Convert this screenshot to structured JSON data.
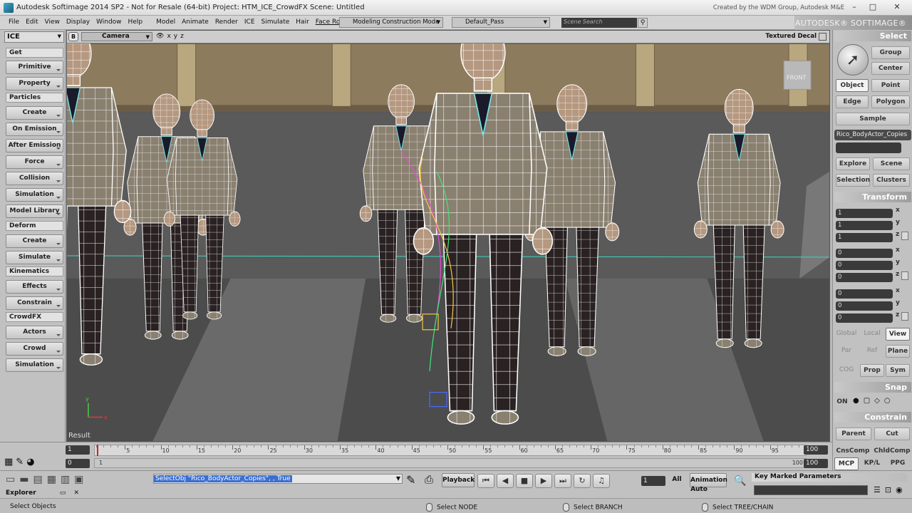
{
  "window": {
    "title": "Autodesk Softimage 2014 SP2  - Not for Resale (64-bit)    Project: HTM_ICE_CrowdFX    Scene: Untitled",
    "credit": "Created by the WDM Group, Autodesk M&E",
    "controls": [
      "–",
      "□",
      "✕"
    ]
  },
  "menubar": {
    "items": [
      "File",
      "Edit",
      "View",
      "Display",
      "Window",
      "Help",
      "Model",
      "Animate",
      "Render",
      "ICE",
      "Simulate",
      "Hair",
      "Face Robot"
    ],
    "mode_combo": "Modeling Construction Mode",
    "pass_combo": "Default_Pass",
    "search_placeholder": "Scene Search",
    "brand": "AUTODESK® SOFTIMAGE®"
  },
  "left_toolbar": {
    "selector": "ICE",
    "sections": [
      {
        "header": "Get",
        "buttons": [
          "Primitive",
          "Property"
        ]
      },
      {
        "header": "Particles",
        "buttons": [
          "Create",
          "On Emission",
          "After Emission",
          "Force",
          "Collision",
          "Simulation",
          "Model Library"
        ]
      },
      {
        "header": "Deform",
        "buttons": [
          "Create",
          "Simulate"
        ]
      },
      {
        "header": "Kinematics",
        "buttons": [
          "Effects",
          "Constrain"
        ]
      },
      {
        "header": "CrowdFX",
        "buttons": [
          "Actors",
          "Crowd",
          "Simulation"
        ]
      }
    ]
  },
  "viewport": {
    "b_label": "B",
    "camera": "Camera",
    "shading": "Textured Decal",
    "tools": [
      "👁",
      "x",
      "y",
      "z"
    ],
    "result_label": "Result",
    "front_label": "FRONT",
    "axis_letters": [
      "y",
      "x"
    ]
  },
  "right_panel": {
    "select_header": "Select",
    "group": "Group",
    "center": "Center",
    "object": "Object",
    "point": "Point",
    "edge": "Edge",
    "polygon": "Polygon",
    "sample": "Sample",
    "selected_name": "Rico_BodyActor_Copies",
    "explore": "Explore",
    "scene": "Scene",
    "selection": "Selection",
    "clusters": "Clusters",
    "transform_header": "Transform",
    "scale": [
      "1",
      "1",
      "1"
    ],
    "rotate": [
      "0",
      "0",
      "0"
    ],
    "translate": [
      "0",
      "0",
      "0"
    ],
    "axes": [
      "x",
      "y",
      "z"
    ],
    "global": "Global",
    "local": "Local",
    "view": "View",
    "par": "Par",
    "ref": "Ref",
    "plane": "Plane",
    "cog": "COG",
    "prop": "Prop",
    "sym": "Sym",
    "snap_header": "Snap",
    "on": "ON",
    "constrain_header": "Constrain",
    "parent": "Parent",
    "cut": "Cut",
    "cnscomp": "CnsComp",
    "chldcomp": "ChldComp",
    "mcp": "MCP",
    "kpl": "KP/L",
    "ppg": "PPG"
  },
  "timeline": {
    "start_field": "1",
    "current_field": "0",
    "first_frame": "1",
    "end_field_top": "100",
    "end_field_bottom": "100",
    "end_frame": "100",
    "ticks": [
      "5",
      "10",
      "15",
      "20",
      "25",
      "30",
      "35",
      "40",
      "45",
      "50",
      "55",
      "60",
      "65",
      "70",
      "75",
      "80",
      "85",
      "90",
      "95"
    ]
  },
  "bottombar": {
    "command": "SelectObj \"Rico_BodyActor_Copies\", , True",
    "playback": "Playback",
    "frame": "1",
    "all": "All",
    "animation": "Animation",
    "auto": "Auto",
    "key_panel": "Key Marked Parameters",
    "explorer_tab": "Explorer",
    "status": "Select Objects",
    "mouse_l": "Select NODE",
    "mouse_m": "Select BRANCH",
    "mouse_r": "Select TREE/CHAIN"
  }
}
